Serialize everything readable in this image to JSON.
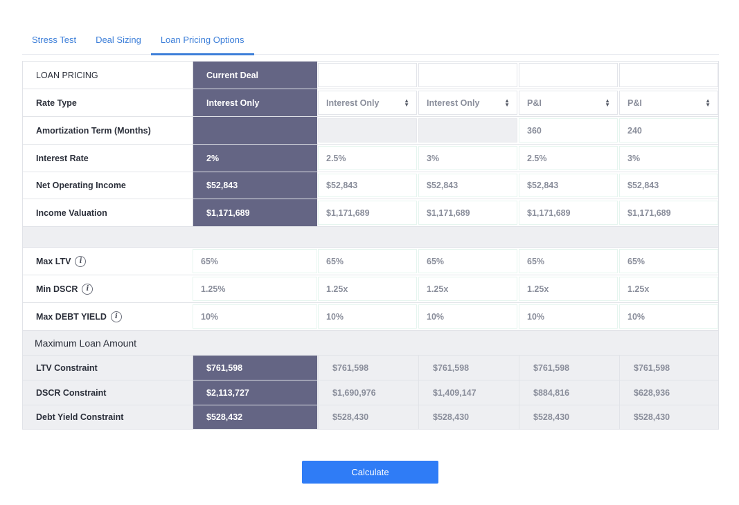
{
  "tabs": [
    {
      "label": "Stress Test",
      "active": false
    },
    {
      "label": "Deal Sizing",
      "active": false
    },
    {
      "label": "Loan Pricing Options",
      "active": true
    }
  ],
  "table": {
    "header_label": "LOAN PRICING",
    "current_header": "Current Deal",
    "rate_type": {
      "label": "Rate Type",
      "current": "Interest Only",
      "options": [
        "Interest Only",
        "Interest Only",
        "P&I",
        "P&I"
      ]
    },
    "amortization": {
      "label": "Amortization Term (Months)",
      "current": "",
      "options": [
        "",
        "",
        "360",
        "240"
      ]
    },
    "interest_rate": {
      "label": "Interest Rate",
      "current": "2%",
      "options": [
        "2.5%",
        "3%",
        "2.5%",
        "3%"
      ]
    },
    "noi": {
      "label": "Net Operating Income",
      "current": "$52,843",
      "options": [
        "$52,843",
        "$52,843",
        "$52,843",
        "$52,843"
      ]
    },
    "income_valuation": {
      "label": "Income Valuation",
      "current": "$1,171,689",
      "options": [
        "$1,171,689",
        "$1,171,689",
        "$1,171,689",
        "$1,171,689"
      ]
    },
    "max_ltv": {
      "label": "Max LTV",
      "current": "65%",
      "options": [
        "65%",
        "65%",
        "65%",
        "65%"
      ]
    },
    "min_dscr": {
      "label": "Min DSCR",
      "current": "1.25%",
      "options": [
        "1.25x",
        "1.25x",
        "1.25x",
        "1.25x"
      ]
    },
    "max_debt_yield": {
      "label": "Max DEBT YIELD",
      "current": "10%",
      "options": [
        "10%",
        "10%",
        "10%",
        "10%"
      ]
    },
    "max_loan_title": "Maximum Loan Amount",
    "ltv_constraint": {
      "label": "LTV Constraint",
      "current": "$761,598",
      "options": [
        "$761,598",
        "$761,598",
        "$761,598",
        "$761,598"
      ]
    },
    "dscr_constraint": {
      "label": "DSCR Constraint",
      "current": "$2,113,727",
      "options": [
        "$1,690,976",
        "$1,409,147",
        "$884,816",
        "$628,936"
      ]
    },
    "debt_yield_constraint": {
      "label": "Debt Yield Constraint",
      "current": "$528,432",
      "options": [
        "$528,430",
        "$528,430",
        "$528,430",
        "$528,430"
      ]
    }
  },
  "info_glyph": "i",
  "calculate_label": "Calculate",
  "colors": {
    "accent": "#2f7cf6",
    "current_column": "#646584",
    "tab_text": "#3d7fd9"
  }
}
